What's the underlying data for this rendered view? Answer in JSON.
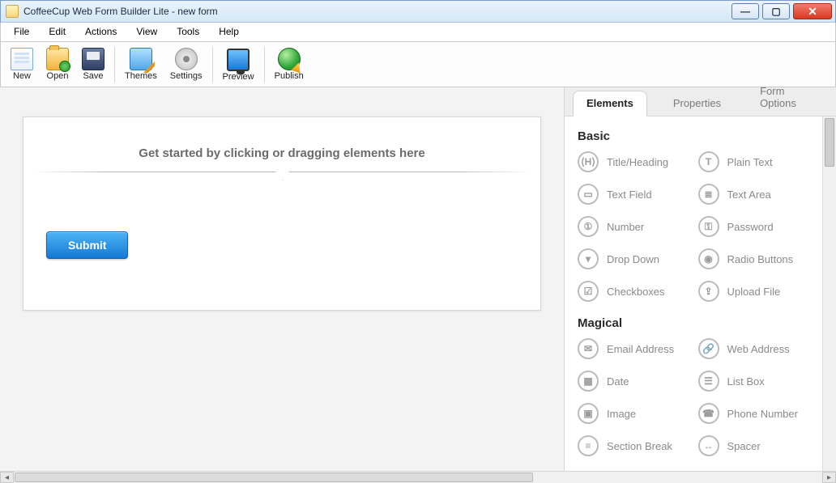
{
  "window": {
    "title": "CoffeeCup Web Form Builder Lite - new form"
  },
  "menu": {
    "items": [
      "File",
      "Edit",
      "Actions",
      "View",
      "Tools",
      "Help"
    ]
  },
  "toolbar": {
    "new": "New",
    "open": "Open",
    "save": "Save",
    "themes": "Themes",
    "settings": "Settings",
    "preview": "Preview",
    "publish": "Publish"
  },
  "canvas": {
    "hint": "Get started by clicking or dragging elements here",
    "submit_label": "Submit"
  },
  "panel": {
    "tabs": {
      "elements": "Elements",
      "properties": "Properties",
      "form_options": "Form Options"
    },
    "sections": {
      "basic": {
        "title": "Basic",
        "items": [
          {
            "glyph": "⟨H⟩",
            "label": "Title/Heading"
          },
          {
            "glyph": "T",
            "label": "Plain Text"
          },
          {
            "glyph": "▭",
            "label": "Text Field"
          },
          {
            "glyph": "≣",
            "label": "Text Area"
          },
          {
            "glyph": "①",
            "label": "Number"
          },
          {
            "glyph": "⚿",
            "label": "Password"
          },
          {
            "glyph": "▾",
            "label": "Drop Down"
          },
          {
            "glyph": "◉",
            "label": "Radio Buttons"
          },
          {
            "glyph": "☑",
            "label": "Checkboxes"
          },
          {
            "glyph": "⇪",
            "label": "Upload File"
          }
        ]
      },
      "magical": {
        "title": "Magical",
        "items": [
          {
            "glyph": "✉",
            "label": "Email Address"
          },
          {
            "glyph": "🔗",
            "label": "Web Address"
          },
          {
            "glyph": "▦",
            "label": "Date"
          },
          {
            "glyph": "☰",
            "label": "List Box"
          },
          {
            "glyph": "▣",
            "label": "Image"
          },
          {
            "glyph": "☎",
            "label": "Phone Number"
          },
          {
            "glyph": "≡",
            "label": "Section Break"
          },
          {
            "glyph": "↔",
            "label": "Spacer"
          }
        ]
      }
    }
  }
}
